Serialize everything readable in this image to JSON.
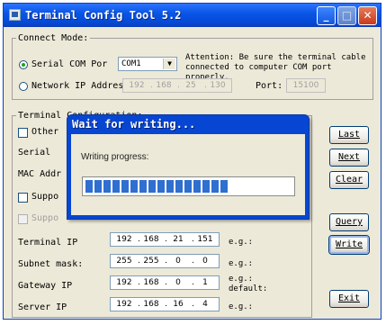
{
  "window": {
    "title": "Terminal Config Tool 5.2"
  },
  "connect_mode": {
    "legend": "Connect Mode:",
    "serial_label": "Serial COM Por",
    "com_value": "COM1",
    "attention": "Attention: Be sure the terminal cable connected to computer COM port properly.",
    "network_label": "Network IP Addres:",
    "network_ip": [
      "192",
      "168",
      "25",
      "130"
    ],
    "port_label": "Port:",
    "port_value": "15100"
  },
  "terminal_config": {
    "legend": "Terminal Configuration:",
    "other_label": "Other",
    "serial_label": "Serial",
    "mac_label": "MAC Addr",
    "support1_label": "Suppo",
    "support2_label": "Suppo",
    "terminal_ip_label": "Terminal IP",
    "terminal_ip": [
      "192",
      "168",
      "21",
      "151"
    ],
    "terminal_ip_hint": "e.g.:",
    "subnet_label": "Subnet mask:",
    "subnet": [
      "255",
      "255",
      "0",
      "0"
    ],
    "subnet_hint": "e.g.:",
    "gateway_label": "Gateway IP",
    "gateway": [
      "192",
      "168",
      "0",
      "1"
    ],
    "gateway_hint": "e.g.:\ndefault:",
    "server_label": "Server IP",
    "server": [
      "192",
      "168",
      "16",
      "4"
    ],
    "server_hint": "e.g.:"
  },
  "buttons": {
    "last": "Last",
    "next": "Next",
    "clear": "Clear",
    "query": "Query",
    "write": "Write",
    "exit": "Exit"
  },
  "dialog": {
    "title": "Wait for writing...",
    "label": "Writing progress:",
    "progress": 0.67,
    "blocks_total": 24
  }
}
